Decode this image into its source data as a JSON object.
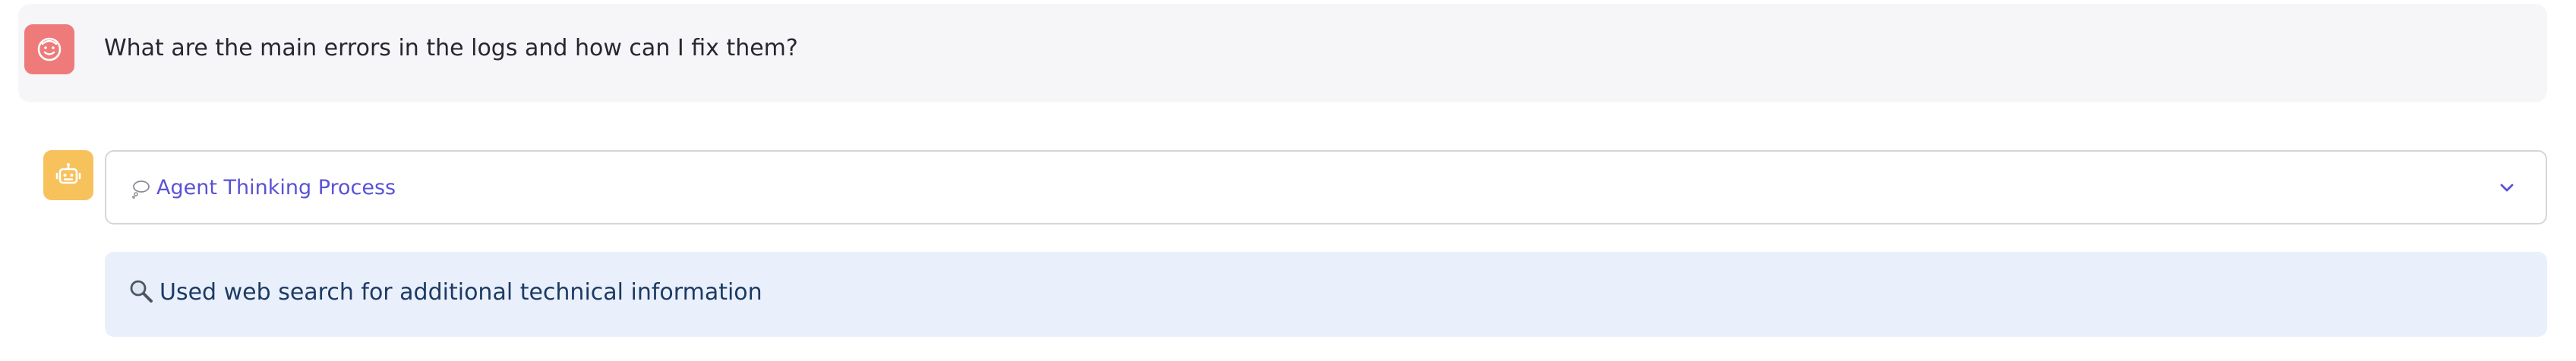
{
  "chat": {
    "user_message": {
      "avatar_icon": "smiley-face-icon",
      "text": "What are the main errors in the logs and how can I fix them?"
    },
    "assistant_message": {
      "avatar_icon": "robot-icon",
      "expander": {
        "icon": "thought-bubble-icon",
        "label": "Agent Thinking Process",
        "state": "collapsed"
      },
      "info": {
        "icon": "magnifier-icon",
        "text": "Used web search for additional technical information"
      }
    }
  },
  "colors": {
    "user_avatar": "#ef7a7a",
    "assistant_avatar": "#f7c15c",
    "expander_label": "#5a52d6",
    "info_background": "#e9f0fb",
    "info_text": "#1c3a63"
  }
}
